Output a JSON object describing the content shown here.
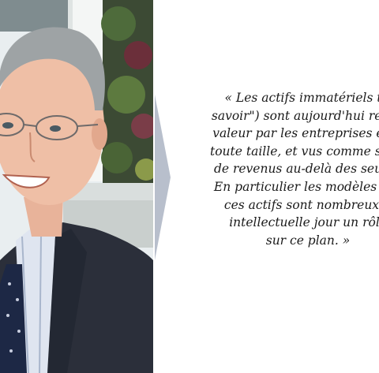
{
  "portrait": {
    "description_icon": "portrait-photo"
  },
  "quote": {
    "lines": [
      "« Les actifs immatériels tec",
      "savoir\") sont aujourd'hui rec",
      "valeur par les entreprises et",
      "toute taille, et vus comme so",
      "de revenus au-delà des seul",
      "En particulier les modèles d",
      "ces actifs sont nombreux",
      "intellectuelle jour un rôl",
      "sur ce plan. »"
    ]
  },
  "colors": {
    "divider": "#b8bfcc",
    "text": "#1a1a1a",
    "background": "#ffffff"
  }
}
